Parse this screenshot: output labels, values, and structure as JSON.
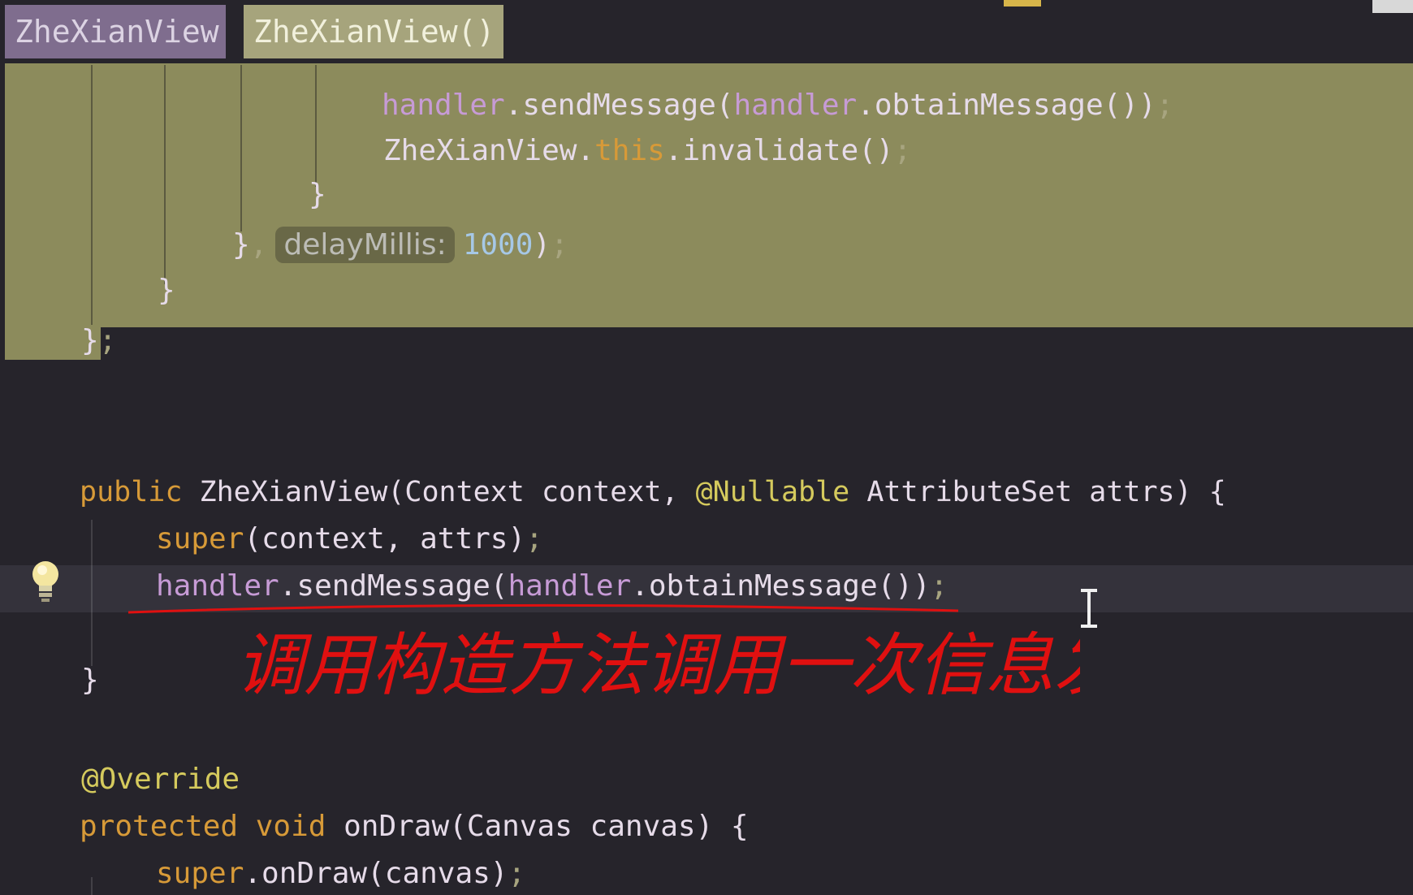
{
  "breadcrumb": {
    "class_label": "ZheXianView",
    "method_label": "ZheXianView()"
  },
  "code": {
    "line1": {
      "obj1": "handler",
      "call": ".sendMessage(",
      "obj2": "handler",
      "rest": ".obtainMessage())",
      "semi": ";"
    },
    "line2": {
      "cls": "ZheXianView.",
      "kw": "this",
      "rest": ".invalidate()",
      "semi": ";"
    },
    "line3": {
      "text": "}"
    },
    "line4": {
      "brace": "}",
      "comma": ",",
      "hint": "delayMillis:",
      "value": "1000",
      "close": ")",
      "semi": ";"
    },
    "line5": {
      "text": "}"
    },
    "line6": {
      "brace": "}",
      "semi": ";"
    },
    "line7": {
      "kw": "public",
      "rest1": " ZheXianView(Context context, ",
      "annotation": "@Nullable",
      "rest2": " AttributeSet attrs) {"
    },
    "line8": {
      "kw": "super",
      "rest": "(context, attrs)",
      "semi": ";"
    },
    "line9": {
      "obj1": "handler",
      "call": ".sendMessage(",
      "obj2": "handler",
      "rest": ".obtainMessage())",
      "semi": ";"
    },
    "line10": {
      "text": "}"
    },
    "line11": {
      "annotation": "@Override"
    },
    "line12": {
      "kw": "protected void",
      "rest": " onDraw(Canvas canvas) {"
    },
    "line13": {
      "kw": "super",
      "rest": ".onDraw(canvas)",
      "semi": ";"
    }
  },
  "annotation_note": "调用构造方法调用一次信息发送。",
  "icons": {
    "intention": "lightbulb-icon",
    "cursor": "text-cursor-icon"
  },
  "colors": {
    "background": "#26242b",
    "highlight": "#8c8b5c",
    "keyword": "#d79a38",
    "field": "#c79bd6",
    "number": "#a6c8e6",
    "annotation": "#d5ca5d",
    "pen": "#e01010"
  }
}
